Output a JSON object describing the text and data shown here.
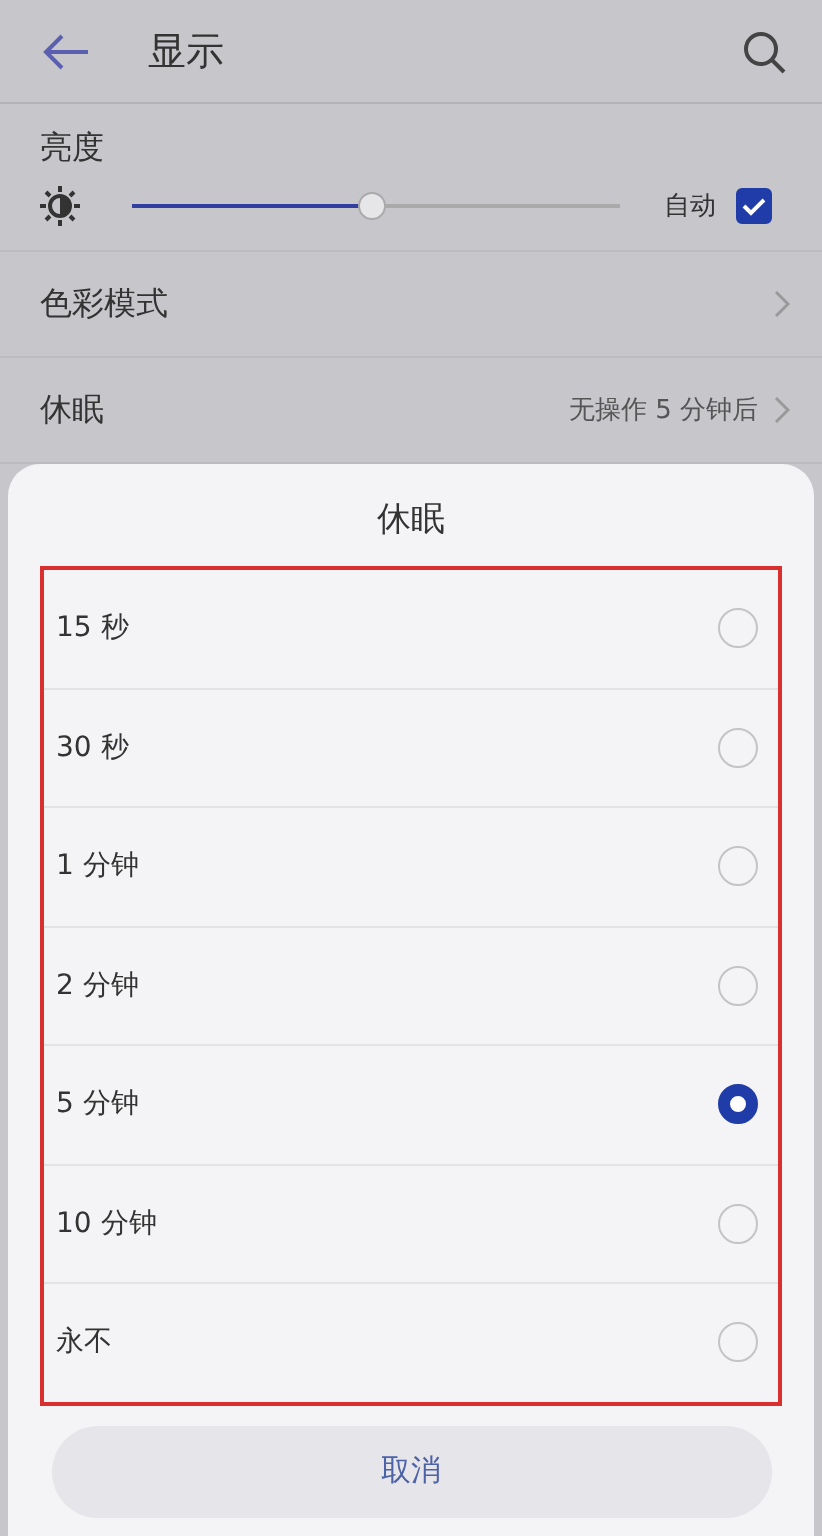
{
  "header": {
    "title": "显示"
  },
  "brightness": {
    "label": "亮度",
    "level": 0.49,
    "auto_label": "自动",
    "auto_checked": true
  },
  "settings": [
    {
      "label": "色彩模式"
    },
    {
      "label": "休眠",
      "value": "无操作 5 分钟后"
    }
  ],
  "sheet": {
    "title": "休眠",
    "options": [
      {
        "label": "15 秒",
        "selected": false
      },
      {
        "label": "30 秒",
        "selected": false
      },
      {
        "label": "1 分钟",
        "selected": false
      },
      {
        "label": "2 分钟",
        "selected": false
      },
      {
        "label": "5 分钟",
        "selected": true
      },
      {
        "label": "10 分钟",
        "selected": false
      },
      {
        "label": "永不",
        "selected": false
      }
    ],
    "cancel": "取消"
  }
}
